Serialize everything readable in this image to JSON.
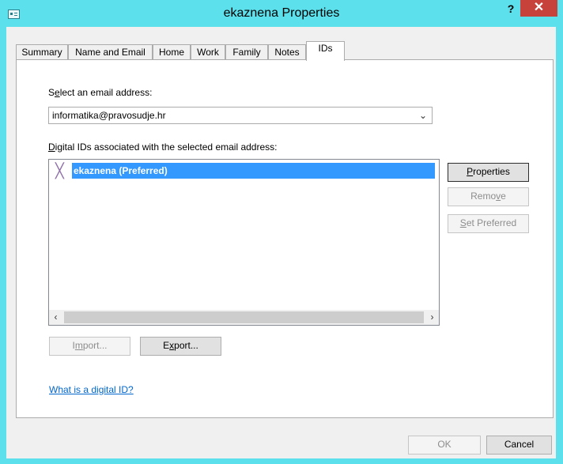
{
  "window": {
    "title": "ekaznena Properties",
    "help_glyph": "?",
    "close_glyph": "✕"
  },
  "tabs": [
    {
      "label": "Summary"
    },
    {
      "label": "Name and Email"
    },
    {
      "label": "Home"
    },
    {
      "label": "Work"
    },
    {
      "label": "Family"
    },
    {
      "label": "Notes"
    },
    {
      "label": "IDs"
    }
  ],
  "ids_tab": {
    "select_label_prefix": "S",
    "select_label_hotkey": "e",
    "select_label_rest": "lect an email address:",
    "email_selected": "informatika@pravosudje.hr",
    "list_label_hotkey": "D",
    "list_label_rest": "igital IDs associated with the selected email address:",
    "ids": [
      {
        "name": "ekaznena  (Preferred)",
        "icon": "certificate-icon"
      }
    ],
    "buttons": {
      "properties_hotkey": "P",
      "properties_rest": "roperties",
      "remove_prefix": "Remo",
      "remove_hotkey": "v",
      "remove_rest": "e",
      "set_preferred_hotkey": "S",
      "set_preferred_rest": "et Preferred",
      "import_prefix": "I",
      "import_hotkey": "m",
      "import_rest": "port...",
      "export_prefix": "E",
      "export_hotkey": "x",
      "export_rest": "port..."
    },
    "help_link": "What is a digital ID?"
  },
  "footer": {
    "ok_label": "OK",
    "cancel_label": "Cancel"
  },
  "colors": {
    "frame": "#5ce0ec",
    "selection": "#3399ff",
    "close": "#c7423a",
    "link": "#0066cc"
  }
}
